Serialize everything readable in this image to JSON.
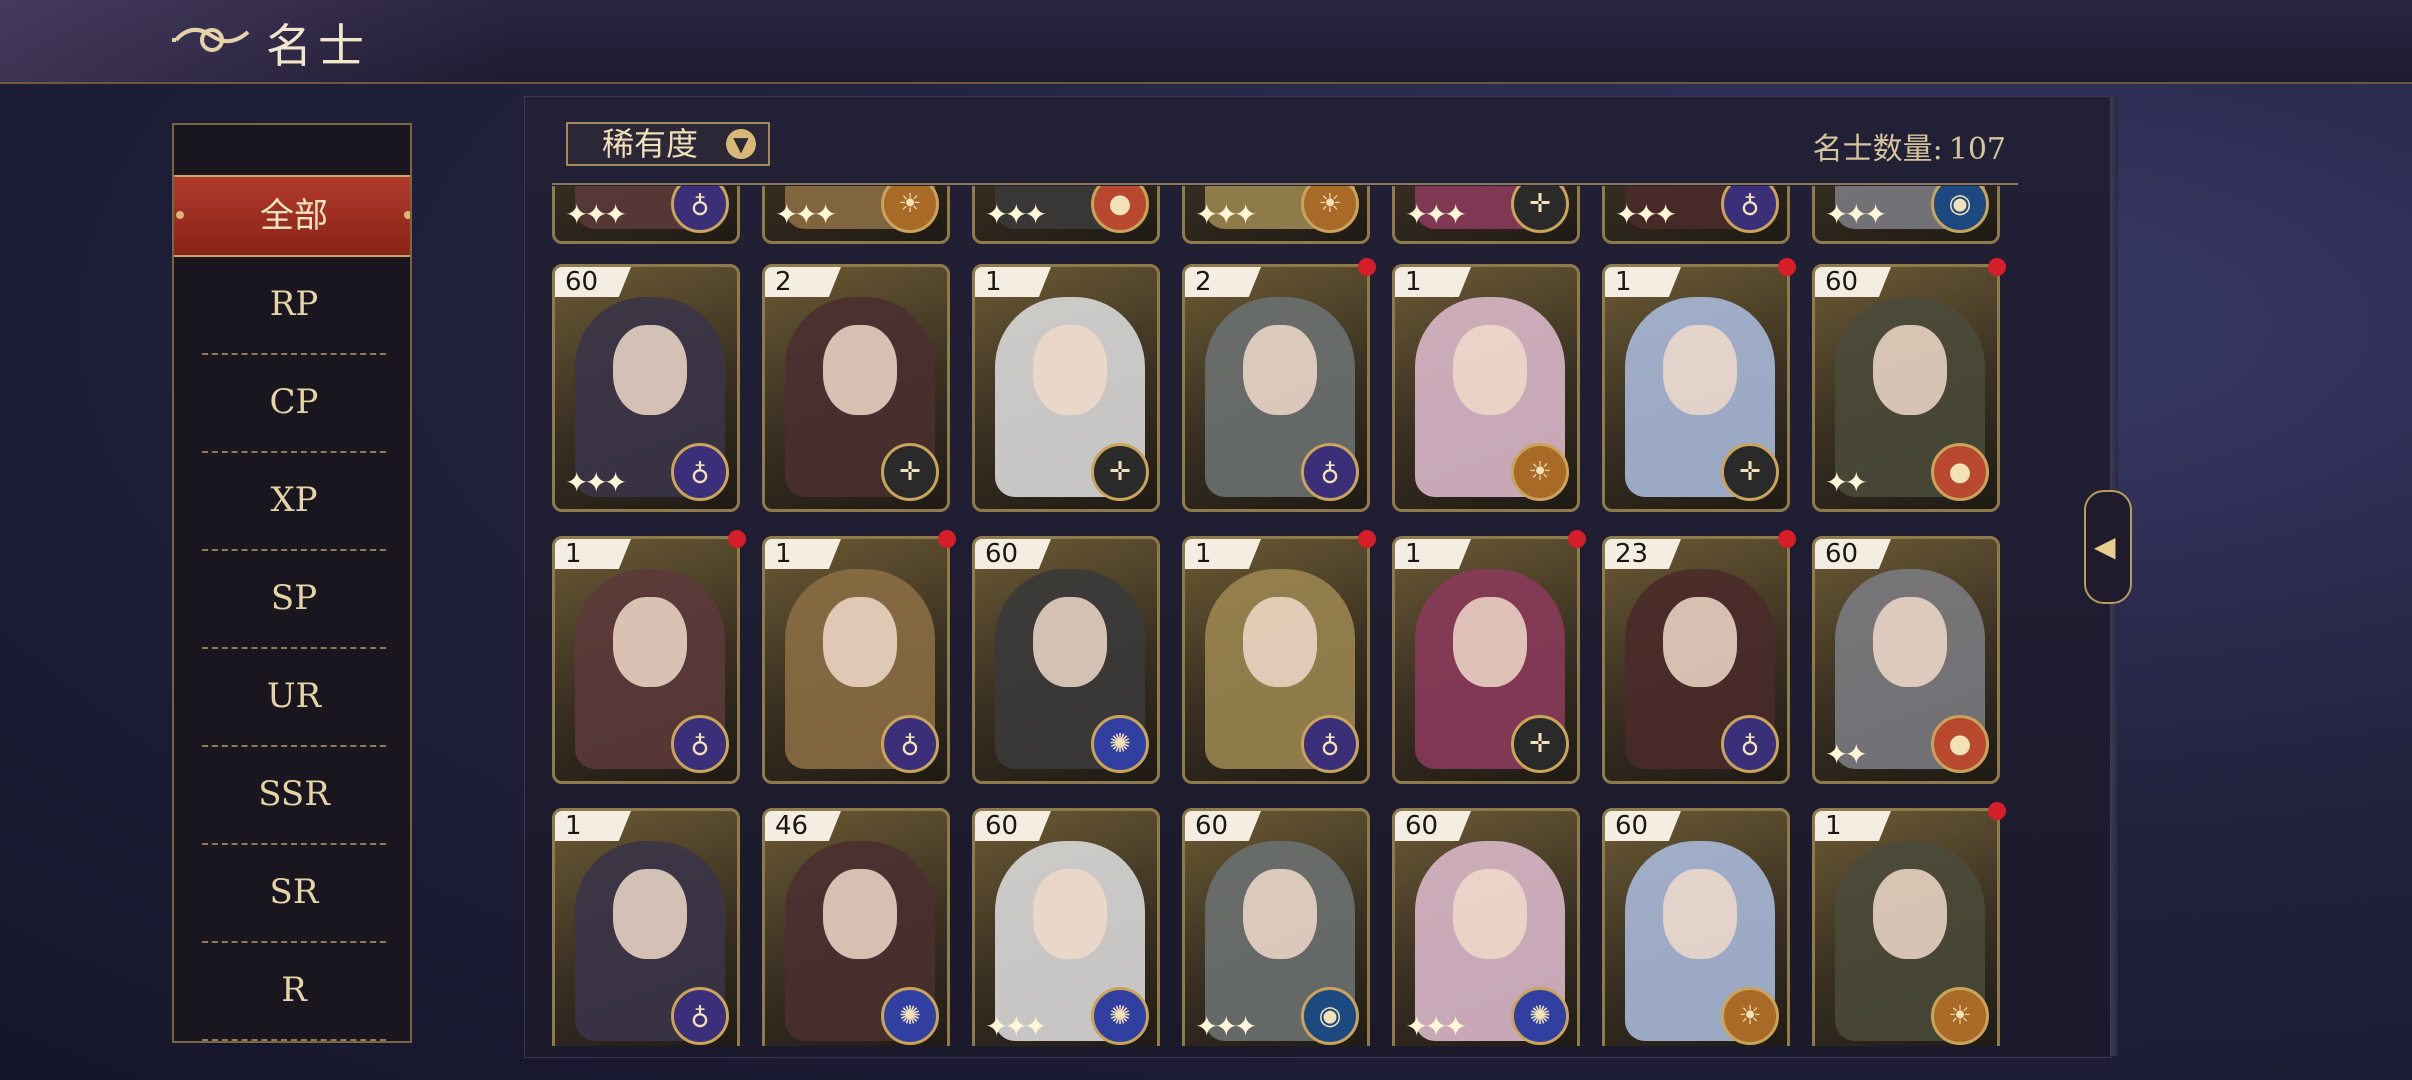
{
  "header": {
    "title": "名士"
  },
  "sidebar": {
    "items": [
      {
        "label": "全部",
        "active": true
      },
      {
        "label": "RP"
      },
      {
        "label": "CP"
      },
      {
        "label": "XP"
      },
      {
        "label": "SP"
      },
      {
        "label": "UR"
      },
      {
        "label": "SSR"
      },
      {
        "label": "SR"
      },
      {
        "label": "R"
      }
    ]
  },
  "toolbar": {
    "sort_label": "稀有度",
    "sort_icon": "chevron-down-icon",
    "count_label": "名士数量:",
    "count_value": "107"
  },
  "cards": [
    {
      "level": "",
      "badge": "planet-icon",
      "badge_color": "#3b2f7a",
      "stars": "✦✦✦",
      "new": false
    },
    {
      "level": "",
      "badge": "sun-icon",
      "badge_color": "#a86a26",
      "stars": "✦✦✦",
      "new": false
    },
    {
      "level": "",
      "badge": "orb-icon",
      "badge_color": "#b8482e",
      "stars": "✦✦✦",
      "new": false
    },
    {
      "level": "",
      "badge": "sun-icon",
      "badge_color": "#a86a26",
      "stars": "✦✦✦",
      "new": false
    },
    {
      "level": "",
      "badge": "compass-icon",
      "badge_color": "#2a2a2a",
      "stars": "✦✦✦",
      "new": false
    },
    {
      "level": "",
      "badge": "planet-icon",
      "badge_color": "#3b2f7a",
      "stars": "✦✦✦",
      "new": false
    },
    {
      "level": "",
      "badge": "globe-icon",
      "badge_color": "#1c4a80",
      "stars": "✦✦✦",
      "new": false
    },
    {
      "level": "60",
      "badge": "planet-icon",
      "badge_color": "#3b2f7a",
      "stars": "✦✦✦",
      "new": false
    },
    {
      "level": "2",
      "badge": "compass-icon",
      "badge_color": "#2a2a2a",
      "stars": "",
      "new": false
    },
    {
      "level": "1",
      "badge": "compass-icon",
      "badge_color": "#2a2a2a",
      "stars": "",
      "new": false
    },
    {
      "level": "2",
      "badge": "planet-icon",
      "badge_color": "#3b2f7a",
      "stars": "",
      "new": true
    },
    {
      "level": "1",
      "badge": "sun-icon",
      "badge_color": "#a86a26",
      "stars": "",
      "new": false
    },
    {
      "level": "1",
      "badge": "compass-icon",
      "badge_color": "#2a2a2a",
      "stars": "",
      "new": true
    },
    {
      "level": "60",
      "badge": "orb-icon",
      "badge_color": "#b8482e",
      "stars": "✦✦",
      "new": true
    },
    {
      "level": "1",
      "badge": "planet-icon",
      "badge_color": "#3b2f7a",
      "stars": "",
      "new": true
    },
    {
      "level": "1",
      "badge": "planet-icon",
      "badge_color": "#3b2f7a",
      "stars": "",
      "new": true
    },
    {
      "level": "60",
      "badge": "galaxy-icon",
      "badge_color": "#3140a0",
      "stars": "",
      "new": false
    },
    {
      "level": "1",
      "badge": "planet-icon",
      "badge_color": "#3b2f7a",
      "stars": "",
      "new": true
    },
    {
      "level": "1",
      "badge": "compass-icon",
      "badge_color": "#2a2a2a",
      "stars": "",
      "new": true
    },
    {
      "level": "23",
      "badge": "planet-icon",
      "badge_color": "#3b2f7a",
      "stars": "",
      "new": true
    },
    {
      "level": "60",
      "badge": "orb-icon",
      "badge_color": "#b8482e",
      "stars": "✦✦",
      "new": false
    },
    {
      "level": "1",
      "badge": "planet-icon",
      "badge_color": "#3b2f7a",
      "stars": "",
      "new": false
    },
    {
      "level": "46",
      "badge": "galaxy-icon",
      "badge_color": "#3140a0",
      "stars": "",
      "new": false
    },
    {
      "level": "60",
      "badge": "galaxy-icon",
      "badge_color": "#3140a0",
      "stars": "✦✦✦",
      "new": false
    },
    {
      "level": "60",
      "badge": "globe-icon",
      "badge_color": "#1c4a80",
      "stars": "✦✦✦",
      "new": false
    },
    {
      "level": "60",
      "badge": "galaxy-icon",
      "badge_color": "#3140a0",
      "stars": "✦✦✦",
      "new": false
    },
    {
      "level": "60",
      "badge": "sun-icon",
      "badge_color": "#a86a26",
      "stars": "",
      "new": false
    },
    {
      "level": "1",
      "badge": "sun-icon",
      "badge_color": "#a86a26",
      "stars": "",
      "new": true
    }
  ],
  "colors": {
    "accent_red": "#b03a2c",
    "gold": "#c9a45a",
    "new_dot": "#d51e2a"
  },
  "side_arrow_icon": "chevron-left-icon"
}
